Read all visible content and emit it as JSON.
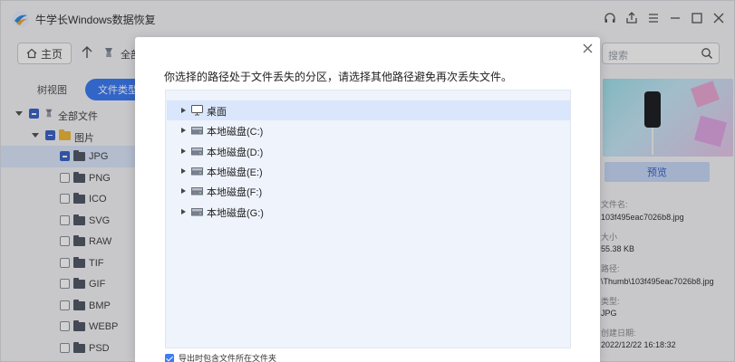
{
  "app": {
    "title": "牛学长Windows数据恢复",
    "logo_icon": "app-logo-icon",
    "window_controls": [
      "headset-icon",
      "share-icon",
      "menu-icon",
      "minimize-icon",
      "maximize-icon",
      "close-icon"
    ]
  },
  "nav": {
    "home_label": "主页",
    "breadcrumb": "全部",
    "search_placeholder": "搜索"
  },
  "view_tabs": {
    "tree_view": "树视图",
    "file_type": "文件类型"
  },
  "tree": {
    "root_label": "全部文件",
    "images_label": "图片",
    "items": [
      "JPG",
      "PNG",
      "ICO",
      "SVG",
      "RAW",
      "TIF",
      "GIF",
      "BMP",
      "WEBP",
      "PSD"
    ],
    "selected_item": "JPG"
  },
  "right_panel": {
    "preview_button": "预览",
    "name_label": "文件名:",
    "name_value": "103f495eac7026b8.jpg",
    "size_label": "大小",
    "size_value": "55.38 KB",
    "path_label": "路径:",
    "path_value": "\\Thumb\\103f495eac7026b8.jpg",
    "type_label": "类型:",
    "type_value": "JPG",
    "created_label": "创建日期:",
    "created_value": "2022/12/22 16:18:32"
  },
  "modal": {
    "message": "你选择的路径处于文件丢失的分区，请选择其他路径避免再次丢失文件。",
    "locations": [
      {
        "label": "桌面",
        "icon": "desktop-icon",
        "selected": true
      },
      {
        "label": "本地磁盘(C:)",
        "icon": "drive-icon",
        "selected": false
      },
      {
        "label": "本地磁盘(D:)",
        "icon": "drive-icon",
        "selected": false
      },
      {
        "label": "本地磁盘(E:)",
        "icon": "drive-icon",
        "selected": false
      },
      {
        "label": "本地磁盘(F:)",
        "icon": "drive-icon",
        "selected": false
      },
      {
        "label": "本地磁盘(G:)",
        "icon": "drive-icon",
        "selected": false
      }
    ],
    "include_folder_label": "导出时包含文件所在文件夹",
    "include_folder_checked": true
  },
  "colors": {
    "accent": "#3d7cf5",
    "checkbox_blue": "#3d64c8",
    "selection": "#dbe7fc",
    "folder_box": "#eef3fc"
  }
}
